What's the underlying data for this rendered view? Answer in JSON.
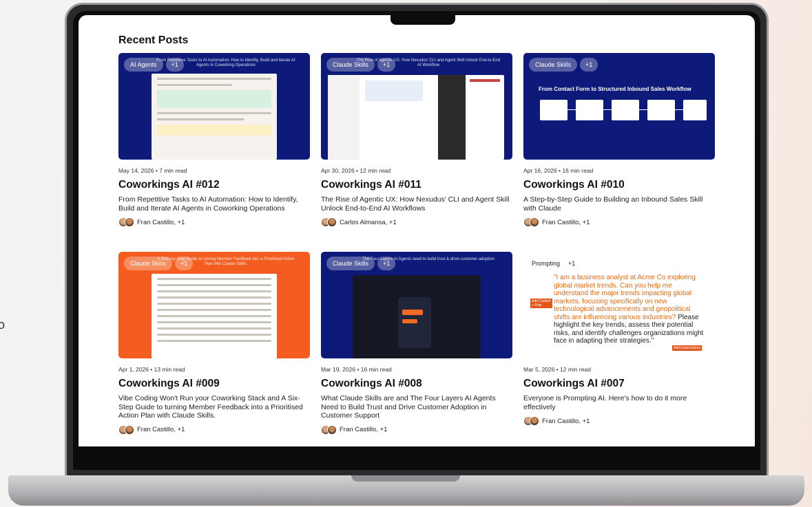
{
  "page": {
    "edge_text": "o",
    "section_title": "Recent Posts"
  },
  "posts": [
    {
      "tags": [
        "AI Agents",
        "+1"
      ],
      "thumb_caption": "From Repetitive Tasks to AI Automation: How to Identify, Build and Iterate AI Agents in Coworking Operations",
      "meta": "May 14, 2026 • 7 min read",
      "title": "Coworkings AI #012",
      "excerpt": "From Repetitive Tasks to AI Automation: How to Identify, Build and Iterate AI Agents in Coworking Operations",
      "authors": "Fran Castillo, +1"
    },
    {
      "tags": [
        "Claude Skills",
        "+1"
      ],
      "thumb_caption": "The Rise of Agentic UX: How Nexudus' CLI and Agent Skill Unlock End-to-End AI Workflow",
      "meta": "Apr 30, 2026 • 12 min read",
      "title": "Coworkings AI #011",
      "excerpt": "The Rise of Agentic UX: How Nexudus' CLI and Agent Skill Unlock End-to-End AI Workflows",
      "authors": "Carlos Almansa, +1"
    },
    {
      "tags": [
        "Claude Skills",
        "+1"
      ],
      "thumb_caption": "From Contact Form to Structured Inbound Sales Workflow",
      "meta": "Apr 16, 2026 • 16 min read",
      "title": "Coworkings AI #010",
      "excerpt": "A Step-by-Step Guide to Building an Inbound Sales Skill with Claude",
      "authors": "Fran Castillo, +1"
    },
    {
      "tags": [
        "Claude Skills",
        "+1"
      ],
      "thumb_caption": "A Step-by-Step Guide to turning Member Feedback into a Prioritised Action Plan with Claude Skills.",
      "meta": "Apr 1, 2026 • 13 min read",
      "title": "Coworkings AI #009",
      "excerpt": "Vibe Coding Won't Run your Coworking Stack and A Six-Step Guide to turning Member Feedback into a Prioritised Action Plan with Claude Skills.",
      "authors": "Fran Castillo, +1"
    },
    {
      "tags": [
        "Claude Skills",
        "+1"
      ],
      "thumb_caption": "The Four Layers AI Agents need to build trust & drive customer adoption",
      "meta": "Mar 19, 2026 • 16 min read",
      "title": "Coworkings AI #008",
      "excerpt": "What Claude Skills are and The Four Layers AI Agents Need to Build Trust and Drive Customer Adoption in Customer Support",
      "authors": "Fran Castillo, +1"
    },
    {
      "tags": [
        "Prompting",
        "+1"
      ],
      "prompt_part1": "\"I am a business analyst at Acme Co exploring global market trends. Can you help me understand the major trends impacting global markets, focusing specifically on new technological advancements and geopolitical shifts are influencing various industries?",
      "prompt_part2": " Please highlight the key trends, assess their potential risks, and identify challenges organizations might face in adapting their strategies.\"",
      "label_left": "Add Context + Role",
      "label_right": "Add Expectations",
      "meta": "Mar 5, 2026 • 12 min read",
      "title": "Coworkings AI #007",
      "excerpt": "Everyone is Prompting AI. Here's how to do it more effectively",
      "authors": "Fran Castillo, +1"
    }
  ],
  "colors": {
    "thumb_blue": "#0d1a7a",
    "thumb_orange": "#f45d1f",
    "prompt_orange": "#e9680f"
  }
}
